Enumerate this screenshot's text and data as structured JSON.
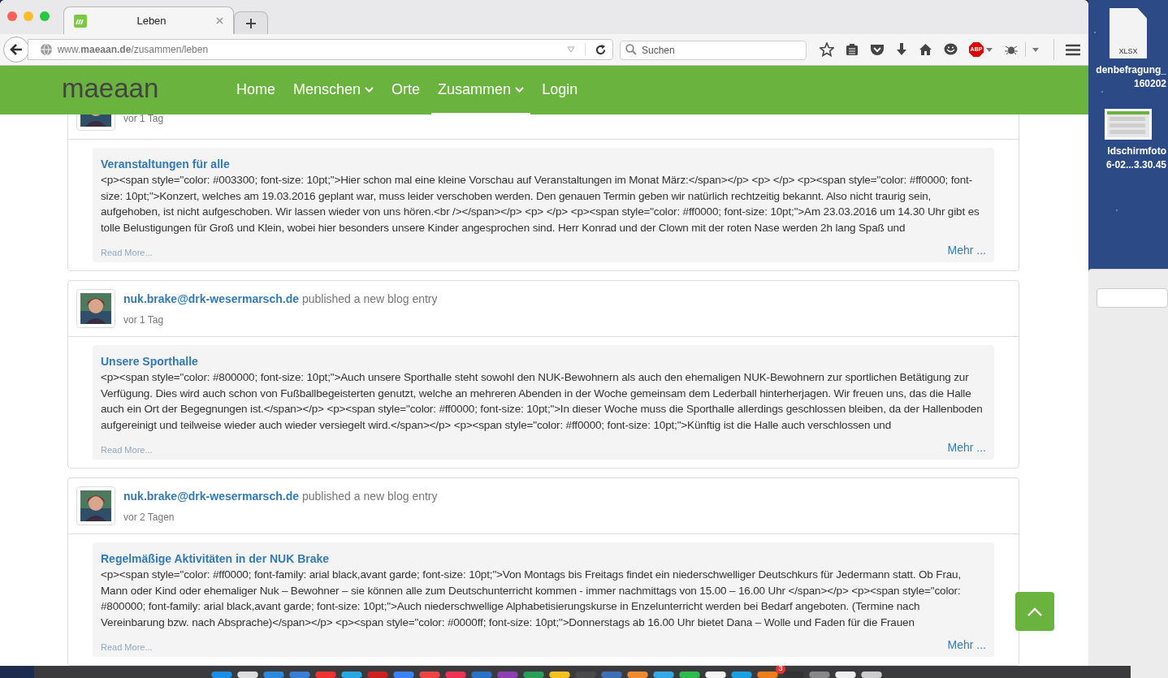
{
  "browser": {
    "tab": {
      "title": "Leben",
      "selected": true
    },
    "url": "www.**maeaan.de**/zusammen/leben",
    "search": {
      "placeholder": "Suchen"
    },
    "adblock_label": "ABP"
  },
  "site": {
    "logo": "maeaan",
    "nav": [
      {
        "label": "Home",
        "dropdown": false,
        "selected": false
      },
      {
        "label": "Menschen",
        "dropdown": true,
        "selected": false
      },
      {
        "label": "Orte",
        "dropdown": false,
        "selected": false
      },
      {
        "label": "Zusammen",
        "dropdown": true,
        "selected": true
      },
      {
        "label": "Login",
        "dropdown": false,
        "selected": false
      }
    ]
  },
  "posts": [
    {
      "time": "vor 1 Tag",
      "title": "Veranstaltungen für alle",
      "excerpt": "<p><span style=\"color: #003300; font-size: 10pt;\">Hier schon mal eine kleine Vorschau auf Veranstaltungen im Monat März:</span></p> <p> </p> <p><span style=\"color: #ff0000; font-size: 10pt;\">Konzert, welches am 19.03.2016 geplant war, muss leider verschoben werden. Den genauen Termin geben wir natürlich rechtzeitig bekannt. Also nicht traurig sein, aufgehoben, ist nicht aufgeschoben. Wir lassen wieder von uns hören.<br /></span></p> <p> </p> <p><span style=\"color: #ff0000; font-size: 10pt;\">Am 23.03.2016 um 14.30 Uhr gibt es tolle Belustigungen für Groß und Klein, wobei hier besonders unsere Kinder angesprochen sind. Herr Konrad und der Clown mit der roten Nase werden 2h lang Spaß und",
      "read_more": "Read More...",
      "more": "Mehr ..."
    },
    {
      "author": "nuk.brake@drk-wesermarsch.de",
      "action": "published a new blog entry",
      "time": "vor 1 Tag",
      "title": "Unsere Sporthalle",
      "excerpt": "<p><span style=\"color: #800000; font-size: 10pt;\">Auch unsere Sporthalle steht sowohl den NUK-Bewohnern als auch den ehemaligen NUK-Bewohnern zur sportlichen Betätigung zur Verfügung. Dies wird auch schon von Fußballbegeisterten genutzt, welche an mehreren Abenden in der Woche gemeinsam dem Lederball hinterherjagen. Wir freuen uns, das die Halle auch ein Ort der Begegnungen ist.</span></p> <p><span style=\"color: #ff0000; font-size: 10pt;\">In dieser Woche muss die Sporthalle allerdings geschlossen bleiben, da der Hallenboden aufgereinigt und teilweise wieder auch wieder versiegelt wird.</span></p> <p><span style=\"color: #ff0000; font-size: 10pt;\">Künftig ist die Halle auch verschlossen und",
      "read_more": "Read More...",
      "more": "Mehr ..."
    },
    {
      "author": "nuk.brake@drk-wesermarsch.de",
      "action": "published a new blog entry",
      "time": "vor 2 Tagen",
      "title": "Regelmäßige Aktivitäten in der NUK Brake",
      "excerpt": "<p><span style=\"color: #ff0000; font-family: arial black,avant garde; font-size: 10pt;\">Von Montags bis Freitags findet ein niederschwelliger Deutschkurs für Jedermann statt. Ob Frau, Mann oder Kind oder ehemaliger Nuk – Bewohner – sie können alle zum Deutschunterricht kommen  - immer nachmittags von 15.00 – 16.00 Uhr </span></p> <p><span style=\"color: #800000; font-family: arial black,avant garde; font-size: 10pt;\">Auch niederschwellige Alphabetisierungskurse in Enzelunterricht werden bei Bedarf angeboten. (Termine nach Vereinbarung bzw. nach Absprache)</span></p> <p><span style=\"color: #0000ff; font-size: 10pt;\">Donnerstags ab 16.00 Uhr bietet Dana – Wolle und Faden für die Frauen",
      "read_more": "Read More...",
      "more": "Mehr ..."
    }
  ],
  "desktop": {
    "icons": [
      {
        "kind": "xlsx",
        "badge": "XLSX",
        "label_lines": [
          "denbefragung_",
          "160202"
        ]
      },
      {
        "kind": "screenshot",
        "label_lines": [
          "ldschirmfoto",
          "6-02...3.30.45"
        ]
      }
    ],
    "dock_badge": "3"
  }
}
